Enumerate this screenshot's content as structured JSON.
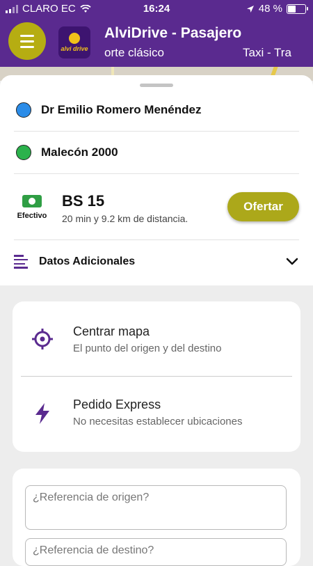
{
  "status_bar": {
    "carrier": "CLARO EC",
    "time": "16:24",
    "battery": "48 %",
    "battery_level": 0.48
  },
  "app_bar": {
    "title": "AlviDrive - Pasajero",
    "marquee_left": "orte clásico",
    "marquee_right": "Taxi - Tra",
    "logo_text": "alvi drive"
  },
  "trip": {
    "origin": "Dr Emilio Romero Menéndez",
    "destination": "Malecón 2000",
    "payment_label": "Efectivo",
    "price": "BS 15",
    "distance_text": "20 min y 9.2 km de distancia.",
    "offer_label": "Ofertar",
    "additional_label": "Datos Adicionales"
  },
  "options": [
    {
      "title": "Centrar mapa",
      "subtitle": "El punto del origen y del destino",
      "icon": "crosshair-icon"
    },
    {
      "title": "Pedido Express",
      "subtitle": "No necesitas establecer ubicaciones",
      "icon": "lightning-icon"
    }
  ],
  "references": {
    "origin_placeholder": "¿Referencia de origen?",
    "destination_placeholder": "¿Referencia de destino?"
  },
  "colors": {
    "brand_purple": "#5a2a8f",
    "accent_olive": "#aca81a",
    "origin_dot": "#2b8ce8",
    "destination_dot": "#2bb24c"
  }
}
